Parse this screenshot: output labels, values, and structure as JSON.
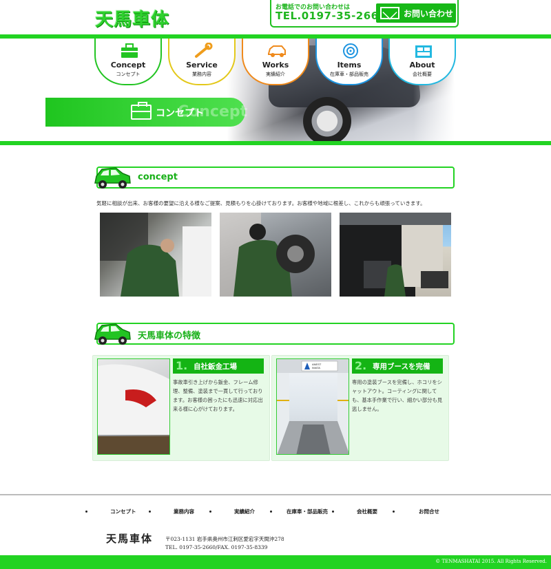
{
  "header": {
    "logo": "天馬車体",
    "contact_label": "お電話でのお問い合わせは",
    "tel": "TEL.0197-35-2660",
    "inquiry_button": "お問い合わせ"
  },
  "nav": [
    {
      "en": "Concept",
      "ja": "コンセプト",
      "icon": "toolbox-icon",
      "color": "#22c422"
    },
    {
      "en": "Service",
      "ja": "業務内容",
      "icon": "wrench-icon",
      "color": "#e3c81a"
    },
    {
      "en": "Works",
      "ja": "実績紹介",
      "icon": "car-icon",
      "color": "#ef8a1c"
    },
    {
      "en": "Items",
      "ja": "在庫車・部品販売",
      "icon": "tire-icon",
      "color": "#1d94e0"
    },
    {
      "en": "About",
      "ja": "会社概要",
      "icon": "building-icon",
      "color": "#22b8e0"
    }
  ],
  "banner": {
    "label": "コンセプト",
    "ghost": "Concept"
  },
  "concept": {
    "title": "concept",
    "text": "気軽に相談が出来、お客様の要望に沿える様なご提案、見積もりを心掛けております。お客様や地域に根差し、これからも頑張っていきます。"
  },
  "features_section": {
    "title": "天馬車体の特徴"
  },
  "features": [
    {
      "num": "1.",
      "title": "自社鈑金工場",
      "text": "事故車引き上げから鈑金、フレーム修理、整備、塗装まで一貫して行っております。お客様の困ったにも迅速に対応出来る様に心がけております。"
    },
    {
      "num": "2.",
      "title": "専用ブースを完備",
      "text": "専用の塗装ブースを完備し、ホコリをシャットアウト。コーティングに関しても、基本手作業で行い、細かい部分も見逃しません。",
      "sign1": "ANEST",
      "sign2": "IWATA"
    }
  ],
  "footer": {
    "nav": [
      "コンセプト",
      "業務内容",
      "実績紹介",
      "在庫車・部品販売",
      "会社概要",
      "お問合せ"
    ],
    "logo": "天馬車体",
    "address": "〒023-1131 岩手県奥州市江刺区愛宕字天間沖278",
    "tel": "TEL. 0197-35-2660/FAX. 0197-35-8339",
    "copyright": "© TENMASHATAI 2015. All Rights Reserved."
  },
  "colors": {
    "brand_green": "#22d322",
    "dark_green": "#14b414",
    "feature_bg": "#e7fae7"
  }
}
